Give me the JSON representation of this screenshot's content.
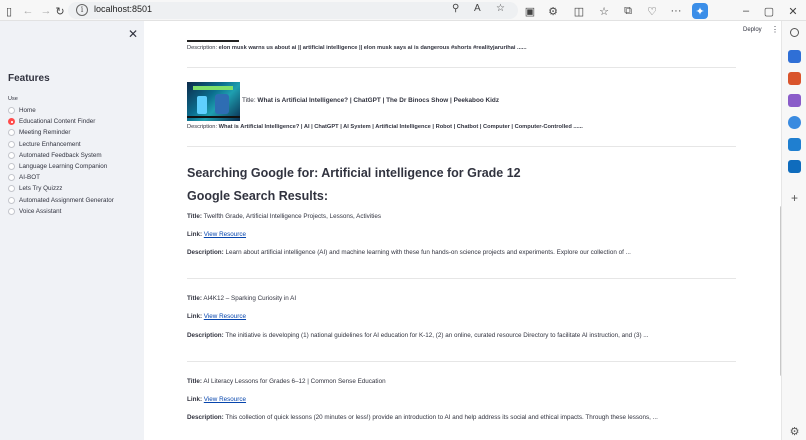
{
  "browser": {
    "url": "localhost:8501"
  },
  "sidebar": {
    "title": "Features",
    "radio_label": "Use",
    "options": [
      "Home",
      "Educational Content Finder",
      "Meeting Reminder",
      "Lecture Enhancement",
      "Automated Feedback System",
      "Language Learning Companion",
      "AI-BOT",
      "Lets Try Quizzz",
      "Automated Assignment Generator",
      "Voice Assistant"
    ],
    "selected": "Educational Content Finder"
  },
  "header": {
    "deploy_label": "Deploy",
    "menu_glyph": "⋮"
  },
  "videos": [
    {
      "description_label": "Description:",
      "description": "elon musk warns us about ai || artificial intelligence || elon musk says ai is dangerous #shorts #realityjarurihai ......"
    },
    {
      "title_label": "Title:",
      "title": "What is Artificial Intelligence? | ChatGPT | The Dr Binocs Show | Peekaboo Kidz",
      "description_label": "Description:",
      "description": "What is Artificial Intelligence? | AI | ChatGPT | AI System | Artificial Intelligence | Robot | Chatbot | Computer | Computer-Controlled ......"
    }
  ],
  "search": {
    "heading": "Searching Google for: Artificial intelligence for Grade 12",
    "results_heading": "Google Search Results:",
    "title_label": "Title:",
    "link_label": "Link:",
    "description_label": "Description:",
    "results": [
      {
        "title": "Twelfth Grade, Artificial Intelligence Projects, Lessons, Activities",
        "link_text": "View Resource",
        "description": "Learn about artificial intelligence (AI) and machine learning with these fun hands-on science projects and experiments. Explore our collection of ..."
      },
      {
        "title": "AI4K12 – Sparking Curiosity in AI",
        "link_text": "View Resource",
        "description": "The initiative is developing (1) national guidelines for AI education for K-12, (2) an online, curated resource Directory to facilitate AI instruction, and (3) ..."
      },
      {
        "title": "AI Literacy Lessons for Grades 6–12 | Common Sense Education",
        "link_text": "View Resource",
        "description": "This collection of quick lessons (20 minutes or less!) provide an introduction to AI and help address its social and ethical impacts. Through these lessons, ..."
      }
    ]
  }
}
